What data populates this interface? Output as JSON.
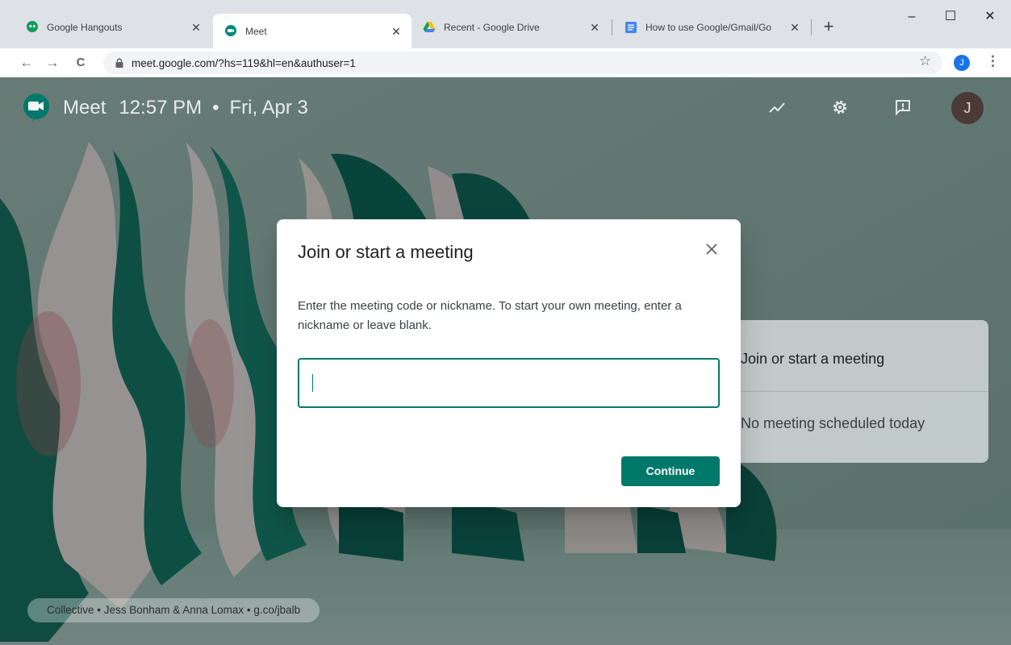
{
  "browser": {
    "tabs": [
      {
        "title": "Google Hangouts",
        "icon": "hangouts-icon",
        "active": false
      },
      {
        "title": "Meet",
        "icon": "meet-icon",
        "active": true
      },
      {
        "title": "Recent - Google Drive",
        "icon": "drive-icon",
        "active": false
      },
      {
        "title": "How to use Google/Gmail/Go",
        "icon": "docs-icon",
        "active": false
      }
    ],
    "close_glyph": "✕",
    "new_tab_glyph": "+",
    "window": {
      "minimize": "–",
      "maximize": "☐",
      "close": "✕"
    },
    "nav": {
      "back": "←",
      "forward": "→",
      "reload": "C"
    },
    "url": "meet.google.com/?hs=119&hl=en&authuser=1",
    "bookmark_glyph": "☆",
    "profile_initial": "J",
    "menu_glyph": "⋮"
  },
  "meet": {
    "app_name": "Meet",
    "time": "12:57 PM",
    "separator": "•",
    "date": "Fri, Apr 3",
    "account_initial": "J",
    "background_card": {
      "start_label": "Join or start a meeting",
      "scheduled_label": "No meeting scheduled today"
    },
    "credit": "Collective • Jess Bonham & Anna Lomax • g.co/jbalb"
  },
  "dialog": {
    "title": "Join or start a meeting",
    "description": "Enter the meeting code or nickname. To start your own meeting, enter a nickname or leave blank.",
    "input_value": "",
    "continue_label": "Continue"
  },
  "colors": {
    "accent": "#00796b",
    "chrome_bg": "#dee1e6",
    "profile_blue": "#1a73e8",
    "avatar_bg": "#4b3a36"
  }
}
